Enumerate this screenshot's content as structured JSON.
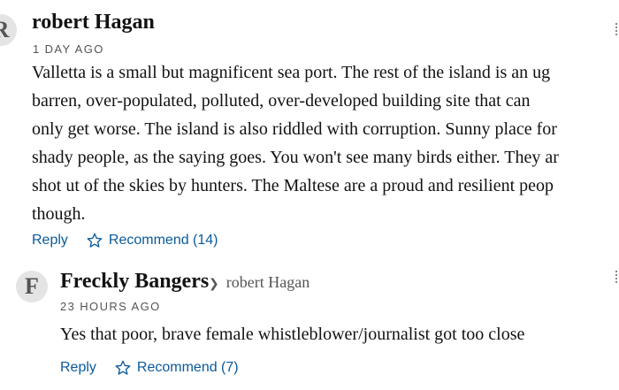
{
  "comments": [
    {
      "avatar_letter": "R",
      "author": "robert Hagan",
      "time": "1 DAY AGO",
      "lines": [
        "Valletta is a small but magnificent sea port. The rest of the island is an ug",
        "barren, over-populated, polluted, over-developed  building site that can",
        "only get worse. The island is also riddled with corruption. Sunny place for",
        "shady people, as the saying goes. You won't see many birds either. They ar",
        "shot ut of the skies by hunters. The Maltese are a proud and resilient peop",
        "though."
      ],
      "reply_label": "Reply",
      "recommend_label": "Recommend (14)"
    },
    {
      "avatar_letter": "F",
      "author": "Freckly Bangers",
      "reply_to": "robert Hagan",
      "time": "23 HOURS AGO",
      "lines": [
        "Yes that poor, brave  female whistleblower/journalist got too close"
      ],
      "reply_label": "Reply",
      "recommend_label": "Recommend (7)"
    }
  ],
  "icons": {
    "star": "star-outline-icon",
    "reply_arrow": "chevron-right-icon"
  },
  "colors": {
    "link": "#0a5a9c",
    "text": "#121212",
    "muted": "#555555",
    "avatar_bg": "#e4e4e4"
  }
}
